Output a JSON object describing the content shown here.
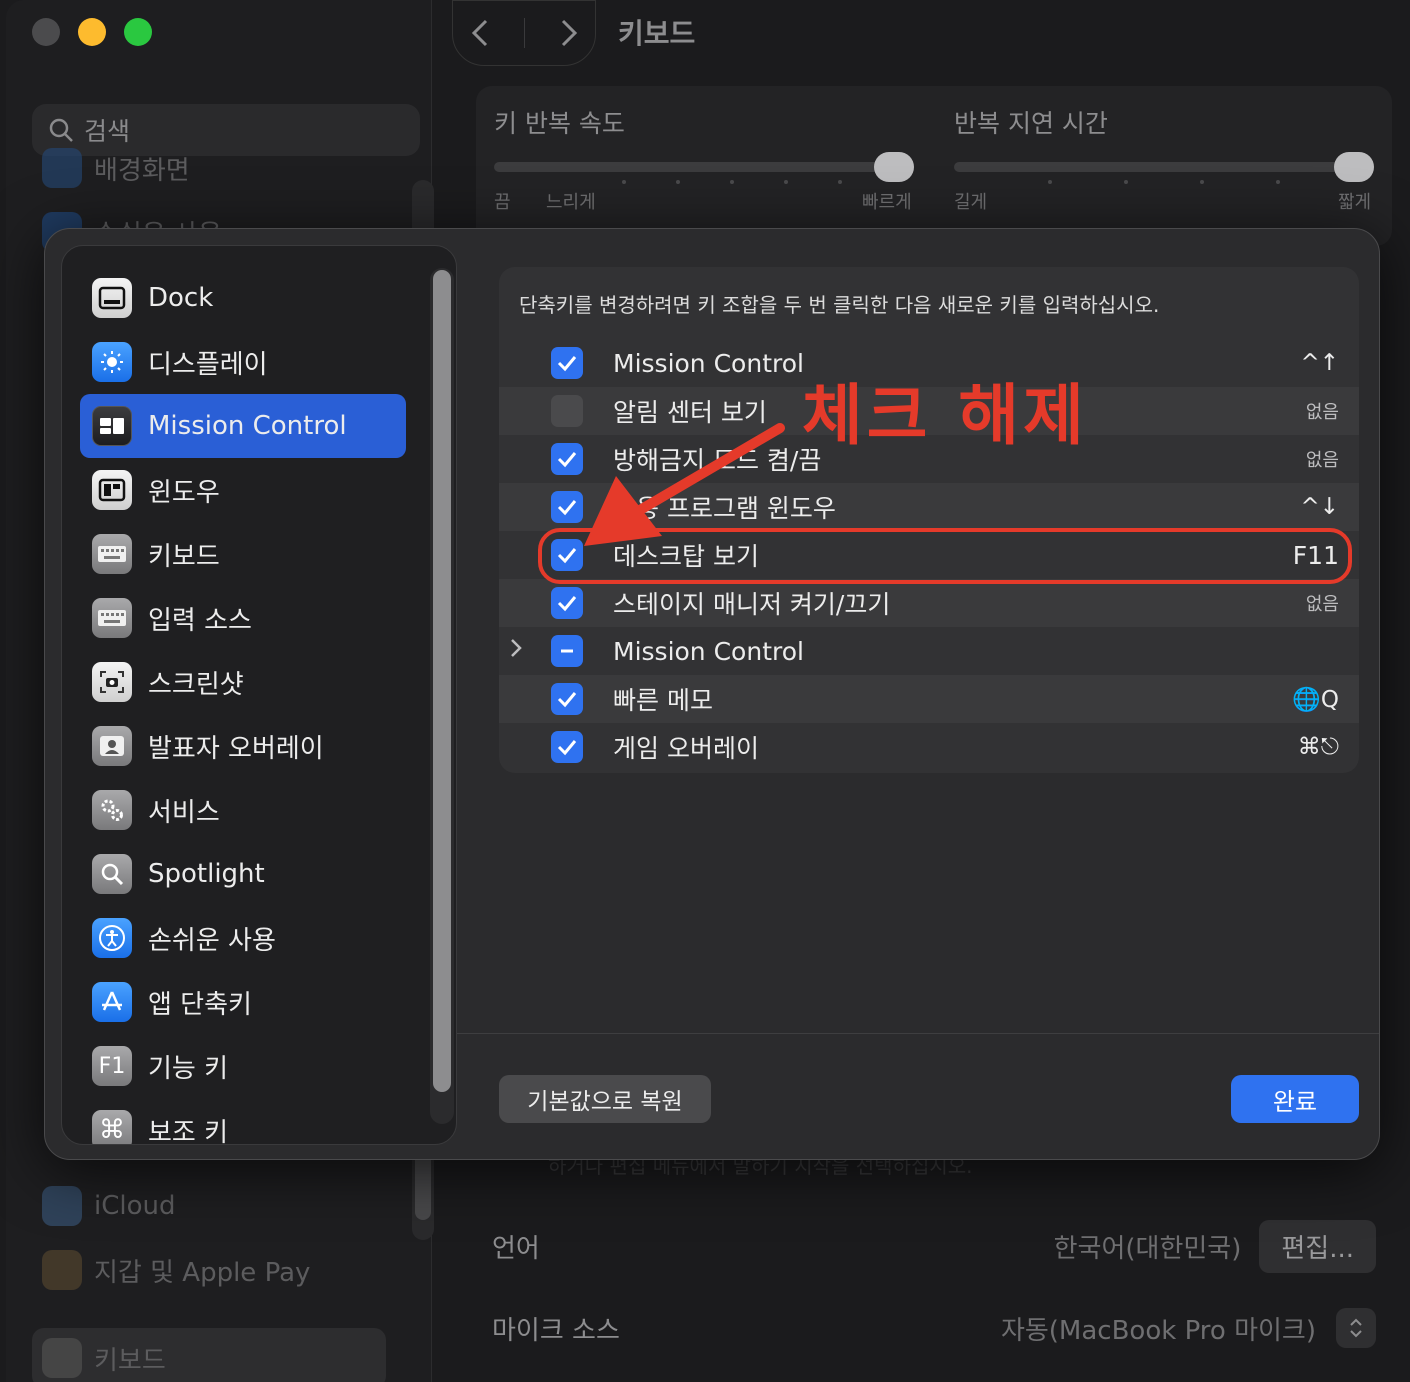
{
  "background": {
    "search_placeholder": "검색",
    "sidebar_items": [
      {
        "label": "배경화면"
      },
      {
        "label": "손쉬운 사용"
      },
      {
        "label": "iCloud"
      },
      {
        "label": "지갑 및 Apple Pay"
      },
      {
        "label": "키보드"
      }
    ],
    "title": "키보드",
    "repeat_rate": {
      "label": "키 반복 속도",
      "left_cap": "끔",
      "mid_cap": "느리게",
      "right_cap": "빠르게",
      "value_fraction": 1.0
    },
    "repeat_delay": {
      "label": "반복 지연 시간",
      "left_cap": "길게",
      "right_cap": "짧게",
      "value_fraction": 1.0
    },
    "faded_text": "하거나 편집 메뉴에서 말하기 지작을 선택하십시오.",
    "language": {
      "label": "언어",
      "value": "한국어(대한민국)",
      "button": "편집..."
    },
    "mic": {
      "label": "마이크 소스",
      "value": "자동(MacBook Pro 마이크)"
    }
  },
  "modal": {
    "sidebar": [
      {
        "label": "Dock",
        "icon": "dock-icon"
      },
      {
        "label": "디스플레이",
        "icon": "display-icon"
      },
      {
        "label": "Mission Control",
        "icon": "mission-control-icon",
        "active": true
      },
      {
        "label": "윈도우",
        "icon": "windows-icon"
      },
      {
        "label": "키보드",
        "icon": "keyboard-icon"
      },
      {
        "label": "입력 소스",
        "icon": "input-sources-icon"
      },
      {
        "label": "스크린샷",
        "icon": "screenshot-icon"
      },
      {
        "label": "발표자 오버레이",
        "icon": "presenter-overlay-icon"
      },
      {
        "label": "서비스",
        "icon": "services-icon"
      },
      {
        "label": "Spotlight",
        "icon": "spotlight-icon"
      },
      {
        "label": "손쉬운 사용",
        "icon": "accessibility-icon"
      },
      {
        "label": "앱 단축키",
        "icon": "app-shortcuts-icon"
      },
      {
        "label": "기능 키",
        "icon": "function-keys-icon"
      },
      {
        "label": "보조 키",
        "icon": "modifier-keys-icon"
      }
    ],
    "description": "단축키를 변경하려면 키 조합을 두 번 클릭한 다음 새로운 키를 입력하십시오.",
    "shortcuts": [
      {
        "label": "Mission Control",
        "key": "^↑",
        "state": "on"
      },
      {
        "label": "알림 센터 보기",
        "key": "없음",
        "state": "off"
      },
      {
        "label": "방해금지 모드 켬/끔",
        "key": "없음",
        "state": "on"
      },
      {
        "label": "응용 프로그램 윈도우",
        "key": "^↓",
        "state": "on"
      },
      {
        "label": "데스크탑 보기",
        "key": "F11",
        "state": "on"
      },
      {
        "label": "스테이지 매니저 켜기/끄기",
        "key": "없음",
        "state": "on"
      },
      {
        "label": "Mission Control",
        "key": "",
        "state": "mixed",
        "expandable": true
      },
      {
        "label": "빠른 메모",
        "key": "🌐Q",
        "state": "on"
      },
      {
        "label": "게임 오버레이",
        "key": "⌘⎋",
        "state": "on"
      }
    ],
    "restore_button": "기본값으로 복원",
    "done_button": "완료"
  },
  "annotation": {
    "text": "체크 해제",
    "color": "#e53a2a"
  }
}
